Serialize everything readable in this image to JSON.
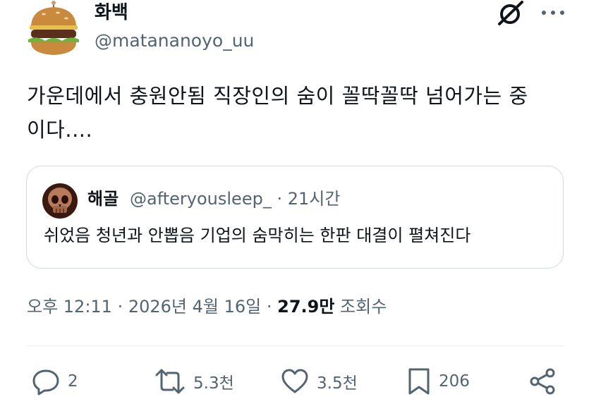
{
  "author": {
    "display_name": "화백",
    "handle": "@matananoyo_uu"
  },
  "tweet": {
    "text_line1": "가운데에서 충원안됨 직장인의 숨이 꼴딱꼴딱 넘어가는 중",
    "text_line2": "이다...."
  },
  "quoted_tweet": {
    "display_name": "해골",
    "handle_and_time": "@afteryousleep_ · 21시간",
    "text": "쉬었음 청년과 안뽑음 기업의 숨막히는 한판 대결이 펼쳐진다"
  },
  "meta": {
    "timestamp": "오후 12:11 · 2026년 4월 16일 · ",
    "views_count": "27.9만",
    "views_label": " 조회수"
  },
  "actions": {
    "replies": "2",
    "reposts": "5.3천",
    "likes": "3.5천",
    "bookmarks": "206"
  },
  "icons": {
    "avatar": "hamburger-avatar",
    "quote_avatar": "skull-avatar",
    "grok": "grok-icon",
    "more": "more-icon",
    "reply": "reply-icon",
    "repost": "repost-icon",
    "like": "heart-icon",
    "bookmark": "bookmark-icon",
    "share": "share-icon"
  },
  "colors": {
    "text": "#0f1419",
    "secondary": "#536471",
    "border": "#cfd9de"
  }
}
